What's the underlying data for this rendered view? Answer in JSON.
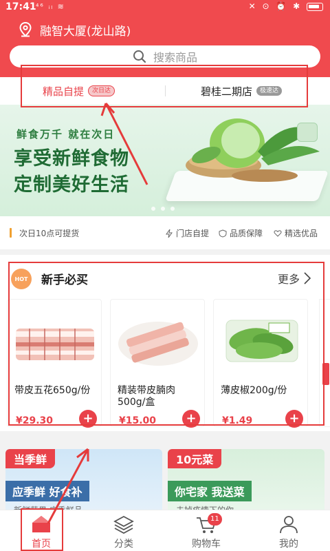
{
  "status_bar": {
    "time": "17:41",
    "left_icons": "⁴⁶ ᵢₗ ≋",
    "right_icons": "✕ ⊙ ⏰ ✱"
  },
  "header": {
    "location": "融智大厦(龙山路)",
    "search_placeholder": "搜索商品"
  },
  "tabs": [
    {
      "label": "精品自提",
      "badge": "次日达",
      "active": true
    },
    {
      "label": "碧桂二期店",
      "badge": "极速达",
      "active": false
    }
  ],
  "banner": {
    "tagline": "鲜食万千 就在次日",
    "line1": "享受新鲜食物",
    "line2": "定制美好生活"
  },
  "info_strip": {
    "pickup": "次日10点可提货",
    "features": [
      "门店自提",
      "品质保障",
      "精选优品"
    ]
  },
  "new_user": {
    "logo": "HOT",
    "title": "新手必买",
    "more": "更多",
    "products": [
      {
        "name": "带皮五花650g/份",
        "price": "¥29.30",
        "add": "+"
      },
      {
        "name": "精装带皮腩肉500g/盒",
        "price": "¥15.00",
        "add": "+"
      },
      {
        "name": "薄皮椒200g/份",
        "price": "¥1.49",
        "add": "+"
      }
    ]
  },
  "promos": [
    {
      "tag": "当季鲜",
      "sub": "应季鲜 好食补",
      "desc": "新鲜蔬果 应季鲜品"
    },
    {
      "tag": "10元菜",
      "sub": "你宅家 我送菜",
      "desc": "去掉疫情下的你"
    }
  ],
  "tabbar": [
    {
      "label": "首页",
      "icon": "home-icon",
      "active": true
    },
    {
      "label": "分类",
      "icon": "layers-icon",
      "active": false
    },
    {
      "label": "购物车",
      "icon": "cart-icon",
      "badge": "11",
      "active": false
    },
    {
      "label": "我的",
      "icon": "user-icon",
      "active": false
    }
  ],
  "colors": {
    "brand_red": "#e9424a",
    "header_red": "#f04a4e",
    "annotation_red": "#e53b3b"
  }
}
